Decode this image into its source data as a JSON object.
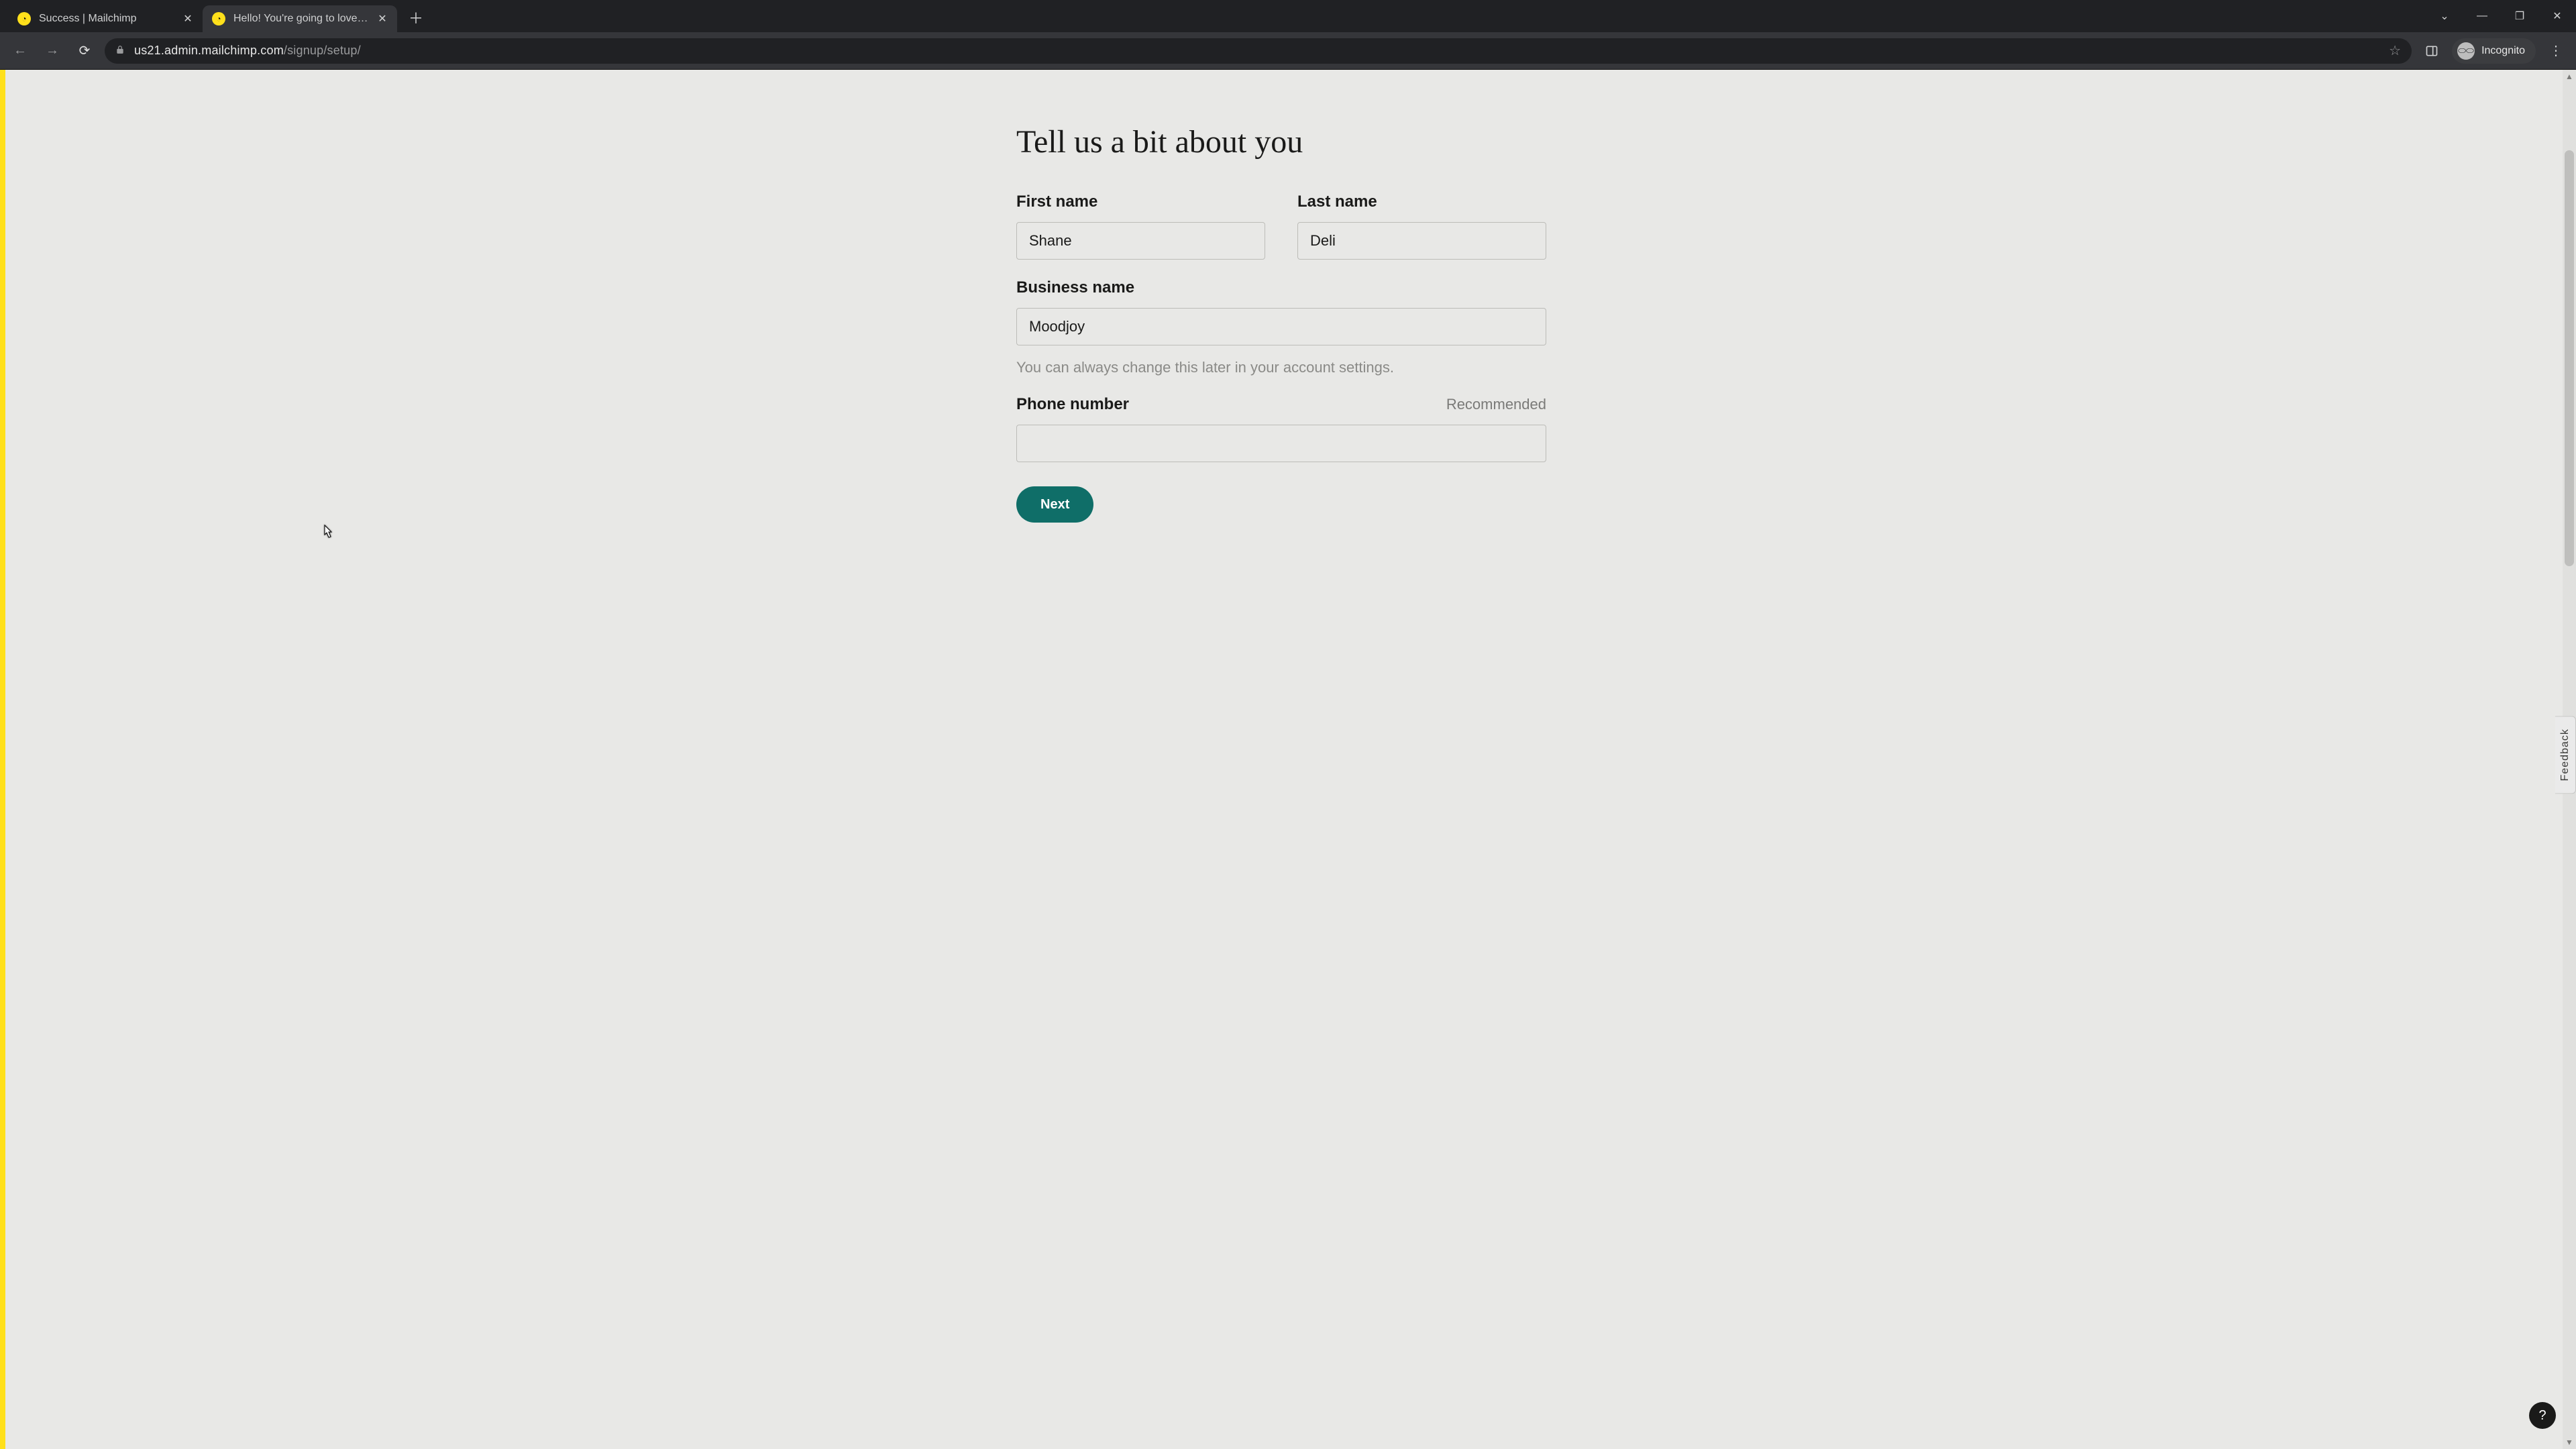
{
  "browser": {
    "tabs": [
      {
        "title": "Success | Mailchimp",
        "active": false
      },
      {
        "title": "Hello! You're going to love it he",
        "active": true
      }
    ],
    "url_host": "us21.admin.mailchimp.com",
    "url_path": "/signup/setup/",
    "incognito_label": "Incognito"
  },
  "page": {
    "title": "Tell us a bit about you",
    "first_name": {
      "label": "First name",
      "value": "Shane"
    },
    "last_name": {
      "label": "Last name",
      "value": "Deli"
    },
    "business": {
      "label": "Business name",
      "value": "Moodjoy",
      "hint": "You can always change this later in your account settings."
    },
    "phone": {
      "label": "Phone number",
      "recommended": "Recommended",
      "value": ""
    },
    "next_button": "Next",
    "feedback_tab": "Feedback",
    "help_fab": "?"
  }
}
